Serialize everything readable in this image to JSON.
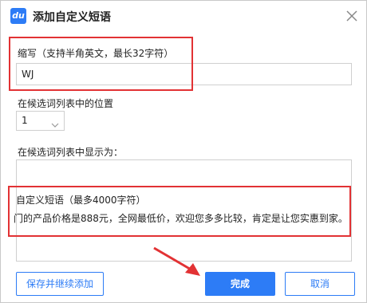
{
  "dialog": {
    "app_icon_text": "du",
    "title": "添加自定义短语"
  },
  "abbreviation": {
    "label": "缩写（支持半角英文，最长32字符）",
    "value": "WJ"
  },
  "position": {
    "label": "在候选词列表中的位置",
    "selected": "1"
  },
  "display": {
    "label": "在候选词列表中显示为：",
    "phrase_label": "自定义短语（最多4000字符）",
    "phrase_text": "门的产品价格是888元，全网最低价，欢迎您多多比较，肯定是让您实惠到家。"
  },
  "buttons": {
    "save_continue": "保存并继续添加",
    "done": "完成",
    "cancel": "取消"
  },
  "colors": {
    "accent": "#2d7cf6",
    "highlight_red": "#e23234"
  },
  "icons": [
    "app-logo-icon",
    "close-icon",
    "chevron-down-icon",
    "pointer-arrow-icon"
  ]
}
